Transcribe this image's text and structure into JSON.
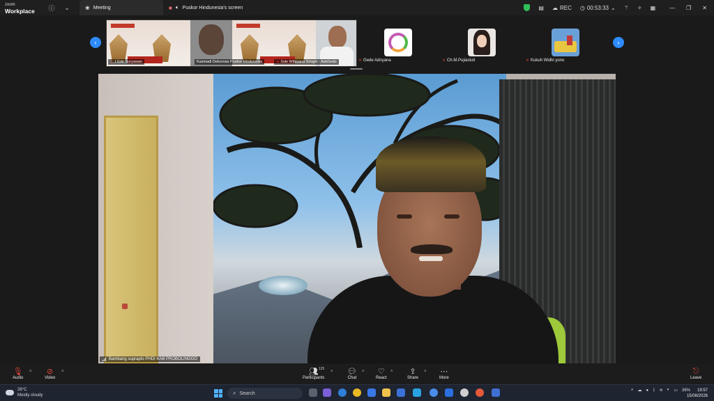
{
  "titlebar": {
    "brand_line1": "zoom",
    "brand_line2": "Workplace",
    "tab_meeting": "Meeting",
    "tab_screen": "Puskor Hindunesia's screen",
    "rec_label": "REC",
    "timer": "00:53:33"
  },
  "gallery": {
    "shared_tiles": [
      {
        "name": "I Gde Suryawan"
      },
      {
        "name": "Kasmadi Dekornas Puskor Hindunesia"
      },
      {
        "name": "Gde Wibisana Simgiri - AskGedo"
      }
    ],
    "participants": [
      {
        "name": "Gede Adnyana"
      },
      {
        "name": "Ch.M.Pujiastuti"
      },
      {
        "name": "Kukuh Widhi yono"
      }
    ]
  },
  "video": {
    "speaker_name": "Bambang suprapto PHDI KAB PROBOLINGGO"
  },
  "toolbar": {
    "audio": "Audio",
    "video": "Video",
    "participants": "Participants",
    "participant_count": "125",
    "chat": "Chat",
    "react": "React",
    "share": "Share",
    "more": "More",
    "leave": "Leave"
  },
  "taskbar": {
    "temperature": "28°C",
    "weather": "Mostly cloudy",
    "search_placeholder": "Search",
    "battery": "36%",
    "time": "19:57",
    "date": "15/08/2026"
  },
  "colors": {
    "accent": "#2d8cff",
    "muted_red": "#e5483b",
    "secure_green": "#2fbf5a"
  }
}
